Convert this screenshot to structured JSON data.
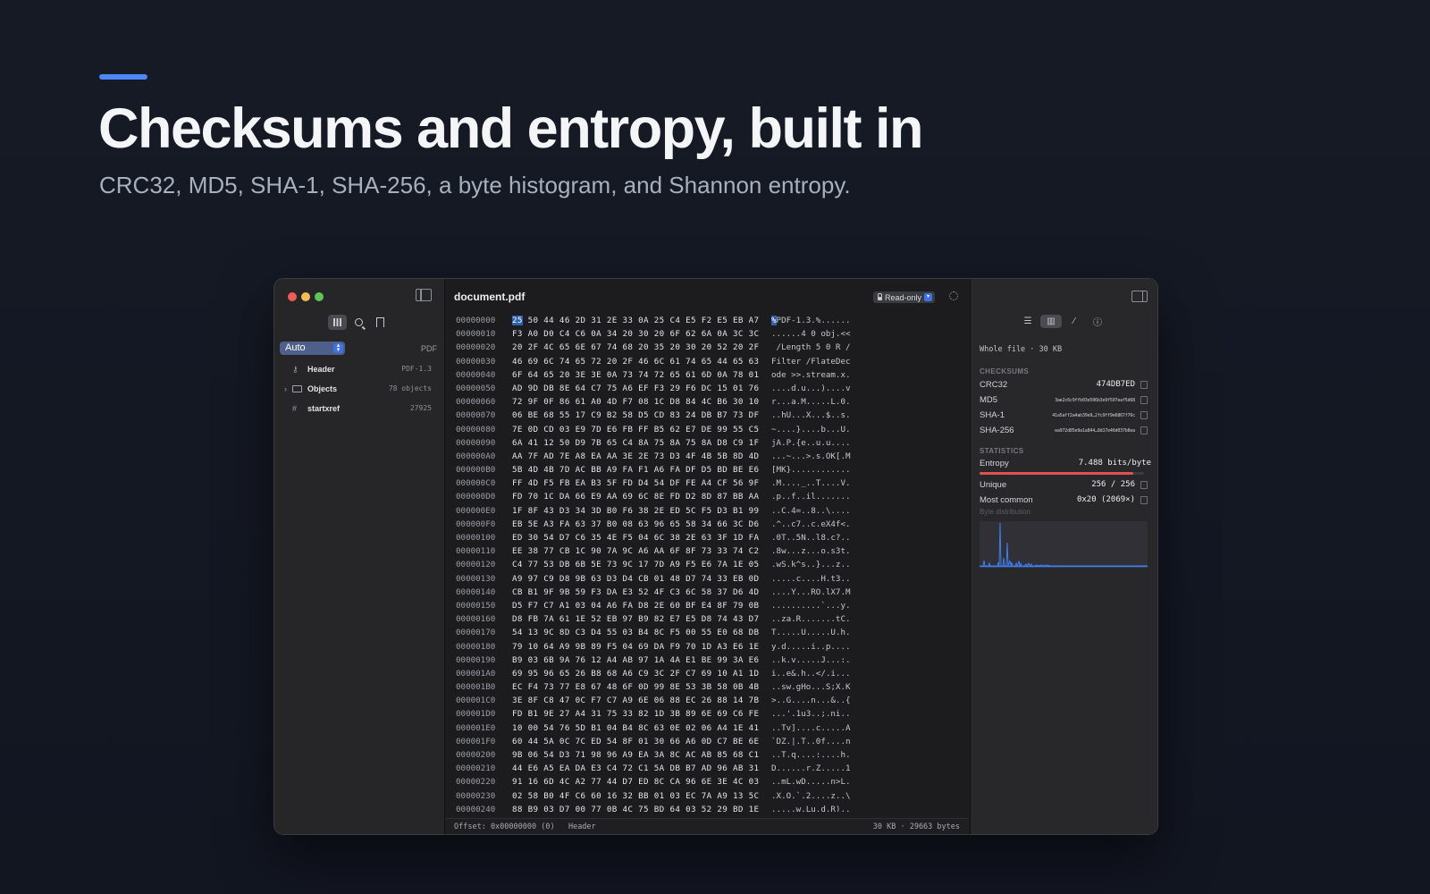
{
  "hero": {
    "headline": "Checksums and entropy, built in",
    "subhead": "CRC32, MD5, SHA-1, SHA-256, a byte histogram, and Shannon entropy."
  },
  "sidebar": {
    "mode_select": "Auto",
    "format_tag": "PDF",
    "items": [
      {
        "label": "Header",
        "value": "PDF-1.3"
      },
      {
        "label": "Objects",
        "value": "78 objects"
      },
      {
        "label": "startxref",
        "value": "27925"
      }
    ]
  },
  "editor": {
    "title": "document.pdf",
    "badge": "Read-only",
    "rows": [
      {
        "offset": "00000000",
        "bytes": "25 50 44 46 2D 31 2E 33 0A 25 C4 E5 F2 E5 EB A7",
        "ascii": "%PDF-1.3.%......"
      },
      {
        "offset": "00000010",
        "bytes": "F3 A0 D0 C4 C6 0A 34 20 30 20 6F 62 6A 0A 3C 3C",
        "ascii": "......4 0 obj.<<"
      },
      {
        "offset": "00000020",
        "bytes": "20 2F 4C 65 6E 67 74 68 20 35 20 30 20 52 20 2F",
        "ascii": " /Length 5 0 R /"
      },
      {
        "offset": "00000030",
        "bytes": "46 69 6C 74 65 72 20 2F 46 6C 61 74 65 44 65 63",
        "ascii": "Filter /FlateDec"
      },
      {
        "offset": "00000040",
        "bytes": "6F 64 65 20 3E 3E 0A 73 74 72 65 61 6D 0A 78 01",
        "ascii": "ode >>.stream.x."
      },
      {
        "offset": "00000050",
        "bytes": "AD 9D DB 8E 64 C7 75 A6 EF F3 29 F6 DC 15 01 76",
        "ascii": "....d.u...)....v"
      },
      {
        "offset": "00000060",
        "bytes": "72 9F 0F 86 61 A0 4D F7 08 1C D8 84 4C B6 30 10",
        "ascii": "r...a.M.....L.0."
      },
      {
        "offset": "00000070",
        "bytes": "06 BE 68 55 17 C9 B2 58 D5 CD 83 24 DB B7 73 DF",
        "ascii": "..hU...X...$..s."
      },
      {
        "offset": "00000080",
        "bytes": "7E 0D CD 03 E9 7D E6 FB FF B5 62 E7 DE 99 55 C5",
        "ascii": "~....}....b...U."
      },
      {
        "offset": "00000090",
        "bytes": "6A 41 12 50 D9 7B 65 C4 8A 75 8A 75 8A D8 C9 1F",
        "ascii": "jA.P.{e..u.u...."
      },
      {
        "offset": "000000A0",
        "bytes": "AA 7F AD 7E A8 EA AA 3E 2E 73 D3 4F 4B 5B 8D 4D",
        "ascii": "...~...>.s.OK[.M"
      },
      {
        "offset": "000000B0",
        "bytes": "5B 4D 4B 7D AC BB A9 FA F1 A6 FA DF D5 BD BE E6",
        "ascii": "[MK}............"
      },
      {
        "offset": "000000C0",
        "bytes": "FF 4D F5 FB EA B3 5F FD D4 54 DF FE A4 CF 56 9F",
        "ascii": ".M...._..T....V."
      },
      {
        "offset": "000000D0",
        "bytes": "FD 70 1C DA 66 E9 AA 69 6C 8E FD D2 8D 87 BB AA",
        "ascii": ".p..f..il......."
      },
      {
        "offset": "000000E0",
        "bytes": "1F 8F 43 D3 34 3D B0 F6 38 2E ED 5C F5 D3 B1 99",
        "ascii": "..C.4=..8..\\...."
      },
      {
        "offset": "000000F0",
        "bytes": "EB 5E A3 FA 63 37 B0 08 63 96 65 58 34 66 3C D6",
        "ascii": ".^..c7..c.eX4f<."
      },
      {
        "offset": "00000100",
        "bytes": "ED 30 54 D7 C6 35 4E F5 04 6C 38 2E 63 3F 1D FA",
        "ascii": ".0T..5N..l8.c?.."
      },
      {
        "offset": "00000110",
        "bytes": "EE 38 77 CB 1C 90 7A 9C A6 AA 6F 8F 73 33 74 C2",
        "ascii": ".8w...z...o.s3t."
      },
      {
        "offset": "00000120",
        "bytes": "C4 77 53 DB 6B 5E 73 9C 17 7D A9 F5 E6 7A 1E 05",
        "ascii": ".wS.k^s..}...z.."
      },
      {
        "offset": "00000130",
        "bytes": "A9 97 C9 D8 9B 63 D3 D4 CB 01 48 D7 74 33 EB 0D",
        "ascii": ".....c....H.t3.."
      },
      {
        "offset": "00000140",
        "bytes": "CB B1 9F 9B 59 F3 DA E3 52 4F C3 6C 58 37 D6 4D",
        "ascii": "....Y...RO.lX7.M"
      },
      {
        "offset": "00000150",
        "bytes": "D5 F7 C7 A1 03 04 A6 FA D8 2E 60 BF E4 8F 79 0B",
        "ascii": "..........`...y."
      },
      {
        "offset": "00000160",
        "bytes": "D8 FB 7A 61 1E 52 EB 97 B9 82 E7 E5 D8 74 43 D7",
        "ascii": "..za.R.......tC."
      },
      {
        "offset": "00000170",
        "bytes": "54 13 9C 8D C3 D4 55 03 B4 8C F5 00 55 E0 68 DB",
        "ascii": "T.....U.....U.h."
      },
      {
        "offset": "00000180",
        "bytes": "79 10 64 A9 9B 89 F5 04 69 DA F9 70 1D A3 E6 1E",
        "ascii": "y.d.....i..p...."
      },
      {
        "offset": "00000190",
        "bytes": "B9 03 6B 9A 76 12 A4 AB 97 1A 4A E1 BE 99 3A E6",
        "ascii": "..k.v.....J...:."
      },
      {
        "offset": "000001A0",
        "bytes": "69 95 96 65 26 B8 68 A6 C9 3C 2F C7 69 10 A1 1D",
        "ascii": "i..e&.h..</.i..."
      },
      {
        "offset": "000001B0",
        "bytes": "EC F4 73 77 E8 67 48 6F 0D 99 8E 53 3B 58 0B 4B",
        "ascii": "..sw.gHo...S;X.K"
      },
      {
        "offset": "000001C0",
        "bytes": "3E 8F C8 47 0C F7 C7 A9 6E 06 88 EC 26 88 14 7B",
        "ascii": ">..G....n...&..{"
      },
      {
        "offset": "000001D0",
        "bytes": "FD B1 9E 27 A4 31 75 33 82 1D 3B 89 6E 69 C6 FE",
        "ascii": "...'.1u3..;.ni.."
      },
      {
        "offset": "000001E0",
        "bytes": "10 00 54 76 5D B1 04 B4 8C 63 0E 02 06 A4 1E 41",
        "ascii": "..Tv]....c.....A"
      },
      {
        "offset": "000001F0",
        "bytes": "60 44 5A 0C 7C ED 54 8F 01 30 66 A6 0D C7 BE 6E",
        "ascii": "`DZ.|.T..0f....n"
      },
      {
        "offset": "00000200",
        "bytes": "9B 06 54 D3 71 98 96 A9 EA 3A 8C AC AB 85 68 C1",
        "ascii": "..T.q....:....h."
      },
      {
        "offset": "00000210",
        "bytes": "44 E6 A5 EA DA E3 C4 72 C1 5A DB B7 AD 96 AB 31",
        "ascii": "D......r.Z.....1"
      },
      {
        "offset": "00000220",
        "bytes": "91 16 6D 4C A2 77 44 D7 ED 8C CA 96 6E 3E 4C 03",
        "ascii": "..mL.wD.....n>L."
      },
      {
        "offset": "00000230",
        "bytes": "02 58 B0 4F C6 60 16 32 BB 01 03 EC 7A A9 13 5C",
        "ascii": ".X.O.`.2....z..\\"
      },
      {
        "offset": "00000240",
        "bytes": "88 B9 03 D7 00 77 0B 4C 75 BD 64 03 52 29 BD 1E",
        "ascii": ".....w.Lu.d.R).."
      }
    ],
    "status": {
      "offset_text": "Offset: 0x00000000 (0)",
      "region": "Header",
      "size_text": "30 KB · 29663 bytes"
    }
  },
  "inspector": {
    "scope": "Whole file · 30 KB",
    "checksums_heading": "CHECKSUMS",
    "checksums": [
      {
        "label": "CRC32",
        "value": "474DB7ED"
      },
      {
        "label": "MD5",
        "value": "3ae2c6c9ffb03e506b3e9f507eaf5d68"
      },
      {
        "label": "SHA-1",
        "value": "41a5aff2a4ab39e9…2fc9ff9e6867f76c"
      },
      {
        "label": "SHA-256",
        "value": "ea972d85e9a1a844…8d17e46d037b8ea"
      }
    ],
    "statistics_heading": "STATISTICS",
    "entropy_label": "Entropy",
    "entropy_value": "7.488 bits/byte",
    "entropy_fraction": 0.936,
    "unique_label": "Unique",
    "unique_value": "256 / 256",
    "most_common_label": "Most common",
    "most_common_value": "0x20 (2069×)",
    "histogram_label": "Byte distribution",
    "colors": {
      "accent": "#4f86f7",
      "entropy_bar": "#e05252",
      "histogram": "#3f7ef0"
    }
  }
}
